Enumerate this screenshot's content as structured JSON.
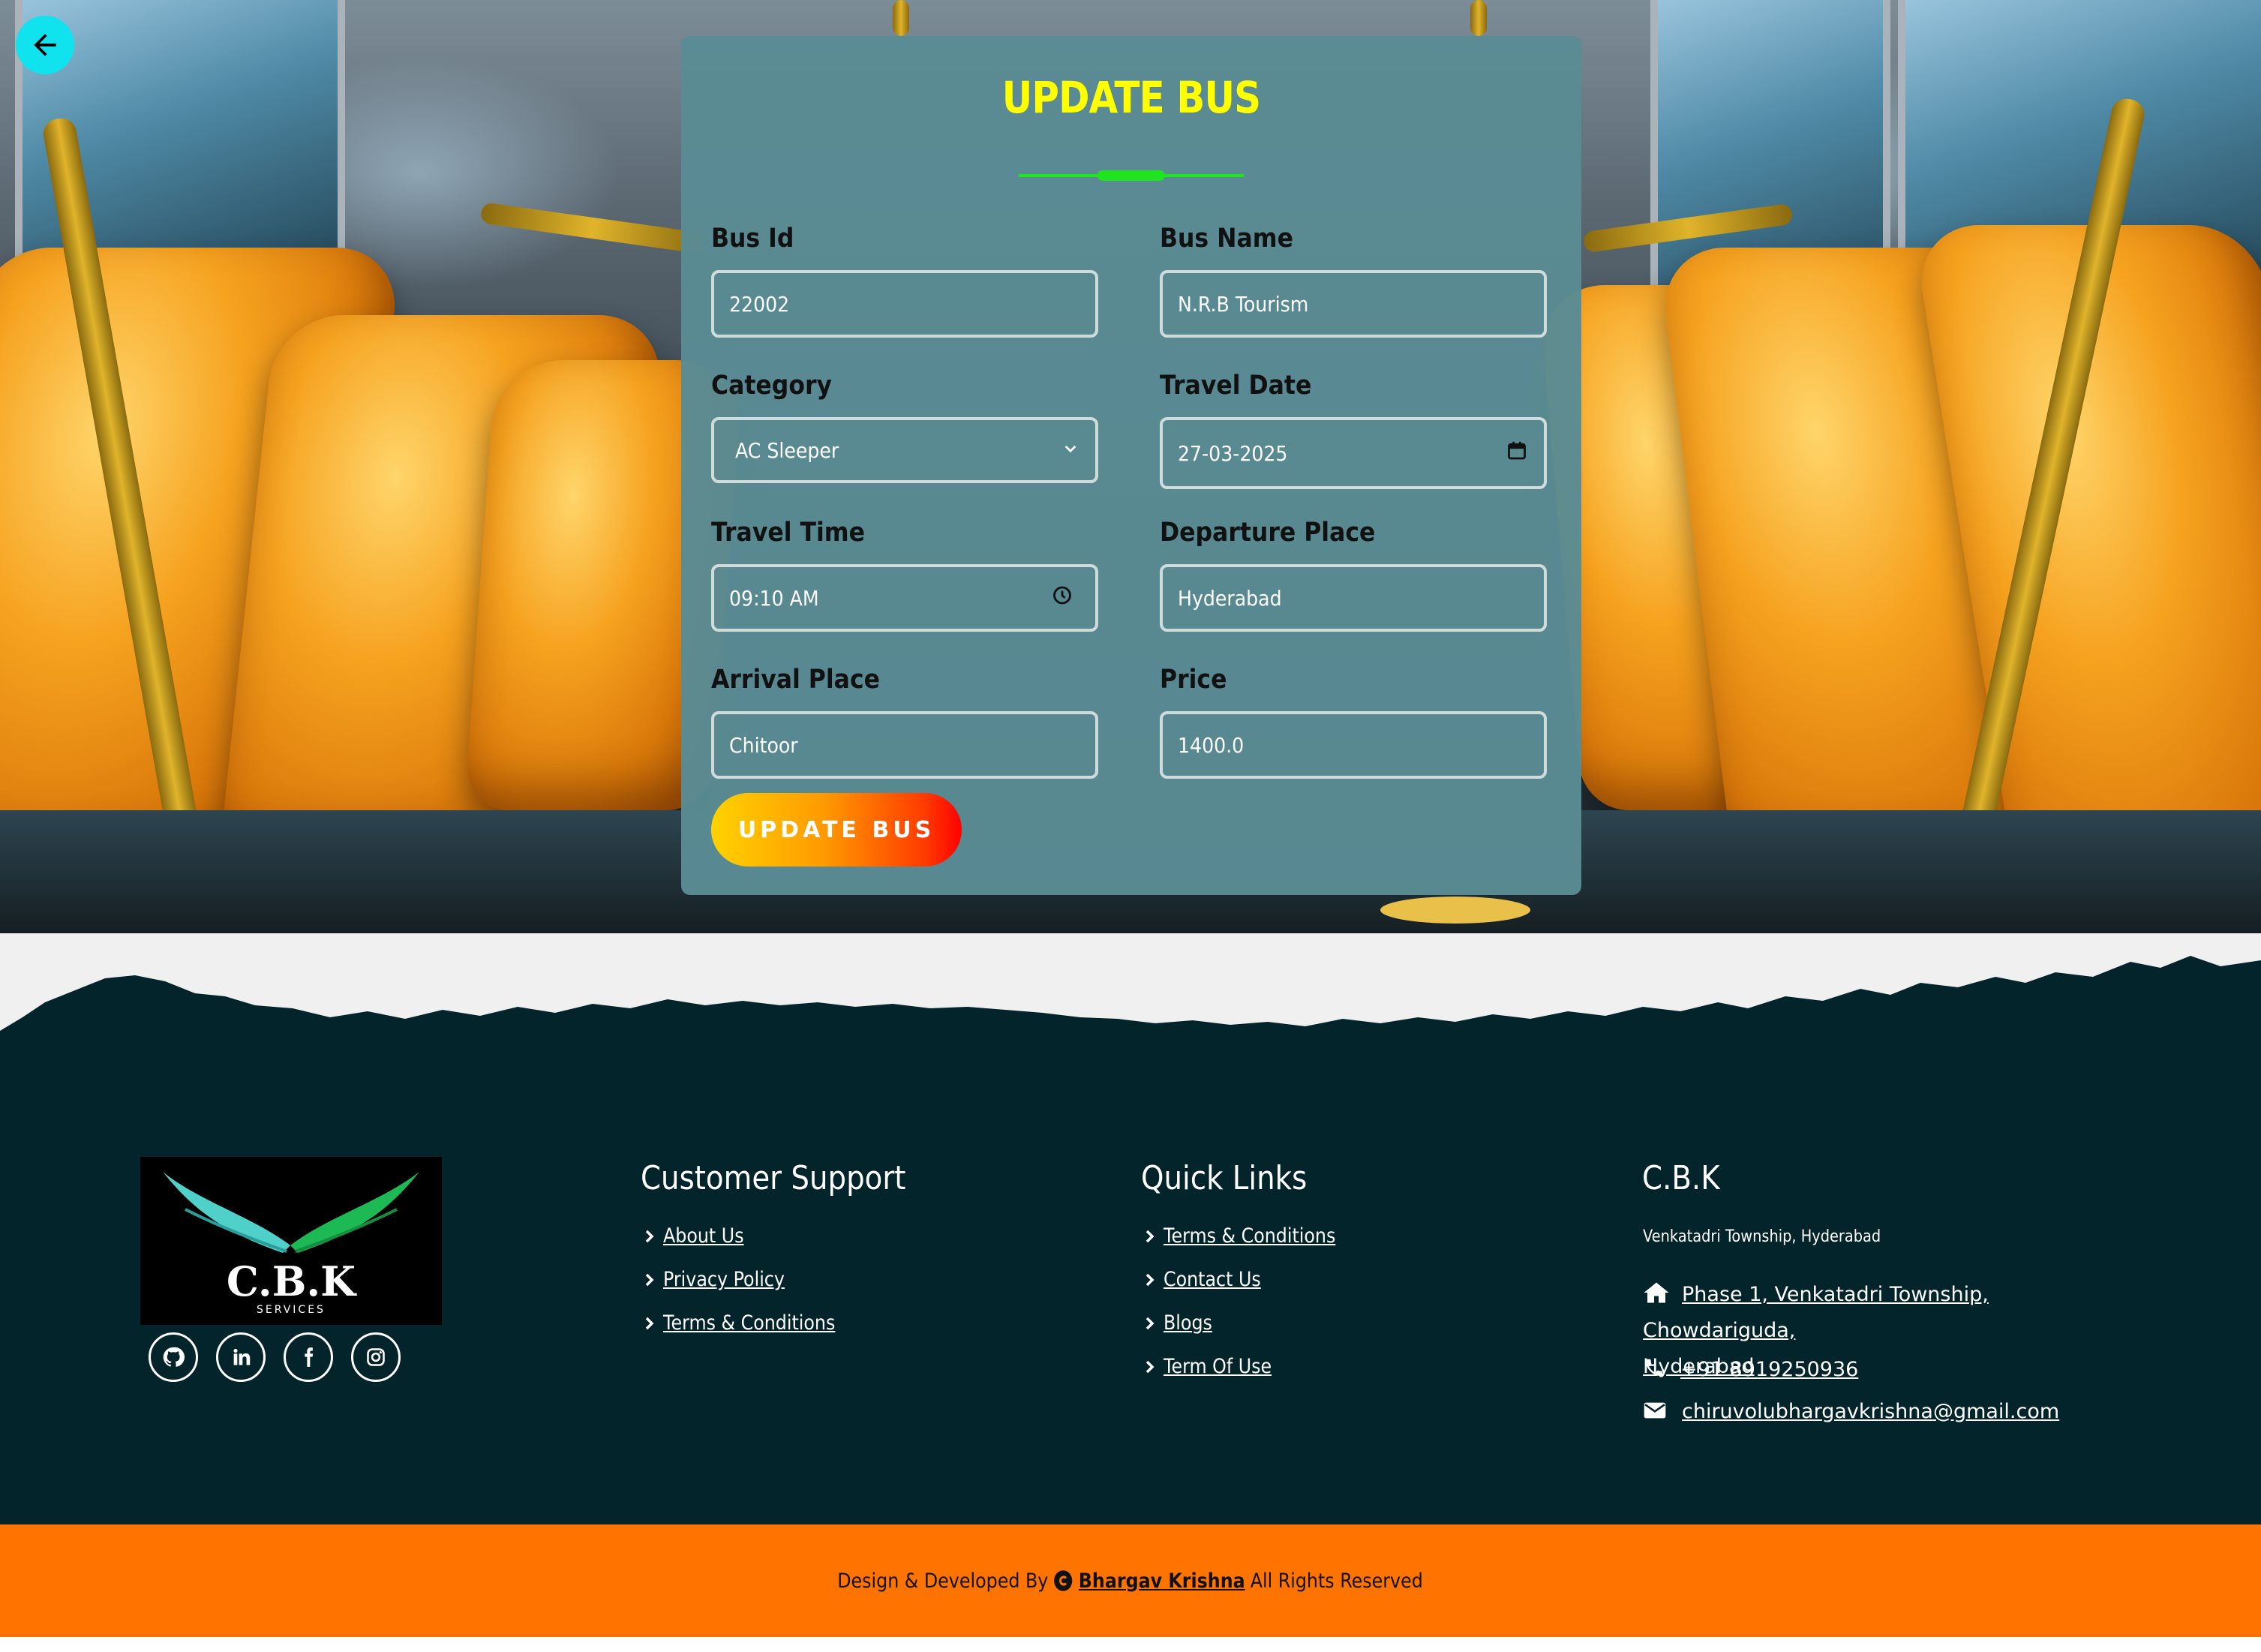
{
  "form": {
    "title": "UPDATE BUS",
    "fields": {
      "bus_id": {
        "label": "Bus Id",
        "value": "22002"
      },
      "bus_name": {
        "label": "Bus Name",
        "value": "N.R.B Tourism"
      },
      "category": {
        "label": "Category",
        "value": "AC Sleeper"
      },
      "travel_date": {
        "label": "Travel Date",
        "value": "27-03-2025"
      },
      "travel_time": {
        "label": "Travel Time",
        "value": "09:10 AM"
      },
      "departure_place": {
        "label": "Departure Place",
        "value": "Hyderabad"
      },
      "arrival_place": {
        "label": "Arrival Place",
        "value": "Chitoor"
      },
      "price": {
        "label": "Price",
        "value": "1400.0"
      }
    },
    "submit_label": "UPDATE BUS"
  },
  "footer": {
    "logo": {
      "brand": "C.B.K",
      "tagline": "SERVICES"
    },
    "social_icons": [
      "github-icon",
      "linkedin-icon",
      "facebook-icon",
      "instagram-icon"
    ],
    "customer_support": {
      "title": "Customer Support",
      "links": [
        "About Us",
        "Privacy Policy",
        "Terms & Conditions"
      ]
    },
    "quick_links": {
      "title": "Quick Links",
      "links": [
        "Terms & Conditions",
        "Contact Us",
        "Blogs",
        "Term Of Use"
      ]
    },
    "company": {
      "title": "C.B.K",
      "subtitle": "Venkatadri Township, Hyderabad",
      "address_line1": "Phase 1, Venkatadri Township, Chowdariguda,",
      "address_line2": "Hyderabad",
      "phone": "+91 8919250936",
      "email": "chiruvolubhargavkrishna@gmail.com"
    }
  },
  "bottom_bar": {
    "prefix": "Design & Developed By",
    "author": "Bhargav Krishna",
    "suffix": "All Rights Reserved"
  },
  "colors": {
    "title": "#ffff00",
    "accent_line": "#1fe51f",
    "back_button": "#10e2ee",
    "card": "#5a8b94",
    "footer": "#04242b",
    "bottom_bar": "#ff7300"
  }
}
